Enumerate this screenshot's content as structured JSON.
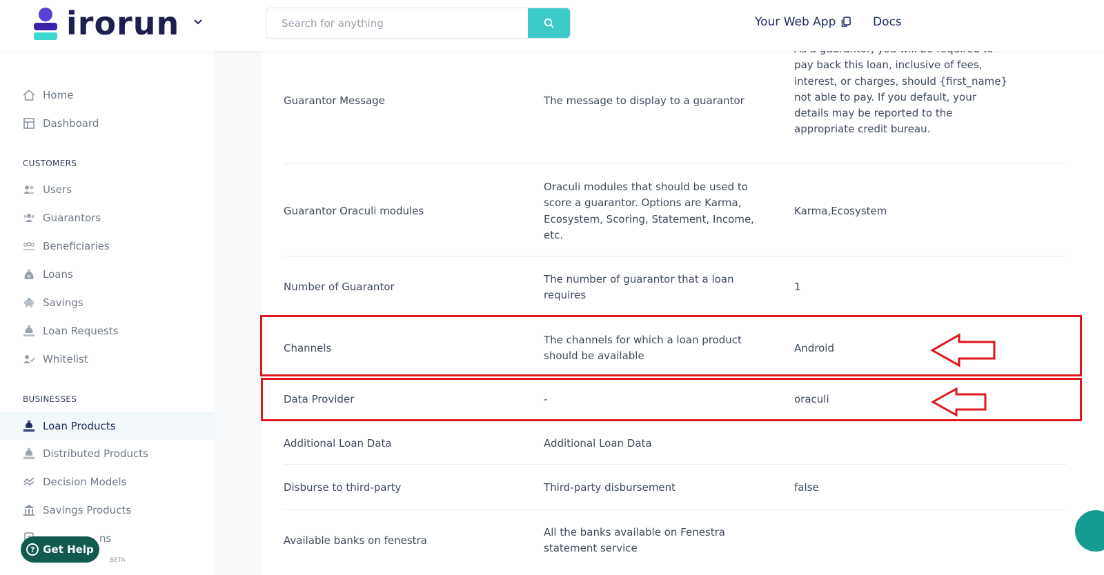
{
  "brand": {
    "name": "irorun"
  },
  "search": {
    "placeholder": "Search for anything"
  },
  "header": {
    "web_app": "Your Web App",
    "docs": "Docs"
  },
  "sidebar": {
    "top": [
      {
        "label": "Home",
        "icon": "home-icon"
      },
      {
        "label": "Dashboard",
        "icon": "dashboard-icon"
      }
    ],
    "customers_heading": "CUSTOMERS",
    "customers": [
      {
        "label": "Users",
        "icon": "users-icon"
      },
      {
        "label": "Guarantors",
        "icon": "guarantors-icon"
      },
      {
        "label": "Beneficiaries",
        "icon": "beneficiaries-icon"
      },
      {
        "label": "Loans",
        "icon": "loan-bag-icon"
      },
      {
        "label": "Savings",
        "icon": "piggy-bank-icon"
      },
      {
        "label": "Loan Requests",
        "icon": "loan-request-icon"
      },
      {
        "label": "Whitelist",
        "icon": "whitelist-icon"
      }
    ],
    "businesses_heading": "BUSINESSES",
    "businesses": [
      {
        "label": "Loan Products",
        "icon": "loan-products-icon",
        "active": true
      },
      {
        "label": "Distributed Products",
        "icon": "distributed-products-icon"
      },
      {
        "label": "Decision Models",
        "icon": "decision-models-icon"
      },
      {
        "label": "Savings Products",
        "icon": "bank-icon"
      },
      {
        "label": "ns",
        "icon": "document-icon"
      }
    ],
    "beta": "BETA",
    "help": "Get Help"
  },
  "table": {
    "rows": [
      {
        "name": "Guarantor Message",
        "description": "The message to display to a guarantor",
        "value": "As a guarantor, you will be required to pay back this loan, inclusive of fees, interest, or charges, should {first_name} not able to pay. If you default, your details may be reported to the appropriate credit bureau."
      },
      {
        "name": "Guarantor Oraculi modules",
        "description": "Oraculi modules that should be used to score a guarantor. Options are Karma, Ecosystem, Scoring, Statement, Income, etc.",
        "value": "Karma,Ecosystem"
      },
      {
        "name": "Number of Guarantor",
        "description": "The number of guarantor that a loan requires",
        "value": "1"
      },
      {
        "name": "Channels",
        "description": "The channels for which a loan product should be available",
        "value": "Android"
      },
      {
        "name": "Data Provider",
        "description": "-",
        "value": "oraculi"
      },
      {
        "name": "Additional Loan Data",
        "description": "Additional Loan Data",
        "value": ""
      },
      {
        "name": "Disburse to third-party",
        "description": "Third-party disbursement",
        "value": "false"
      },
      {
        "name": "Available banks on fenestra",
        "description": "All the banks available on Fenestra statement service",
        "value": ""
      }
    ]
  },
  "colors": {
    "accent": "#3ccbc9",
    "brand": "#3b22a8",
    "highlight": "#e0161b",
    "help": "#115a4e"
  }
}
